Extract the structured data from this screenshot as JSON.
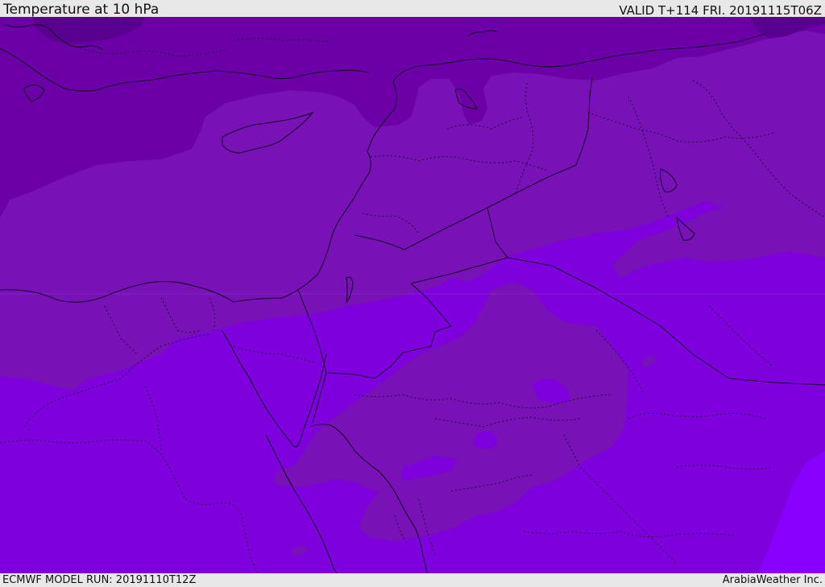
{
  "header": {
    "title": "Temperature at 10 hPa",
    "valid": "VALID T+114 FRI. 20191115T06Z"
  },
  "footer": {
    "model_run": "ECMWF MODEL RUN: 20191110T12Z",
    "credit": "ArabiaWeather Inc."
  },
  "colors": {
    "band_darkest": "#5a0090",
    "band_dark": "#6a00a6",
    "band_mid": "#7811b6",
    "band_bright": "#7e00dc",
    "band_brightest": "#8a00ff",
    "lines": "#1a0030"
  }
}
